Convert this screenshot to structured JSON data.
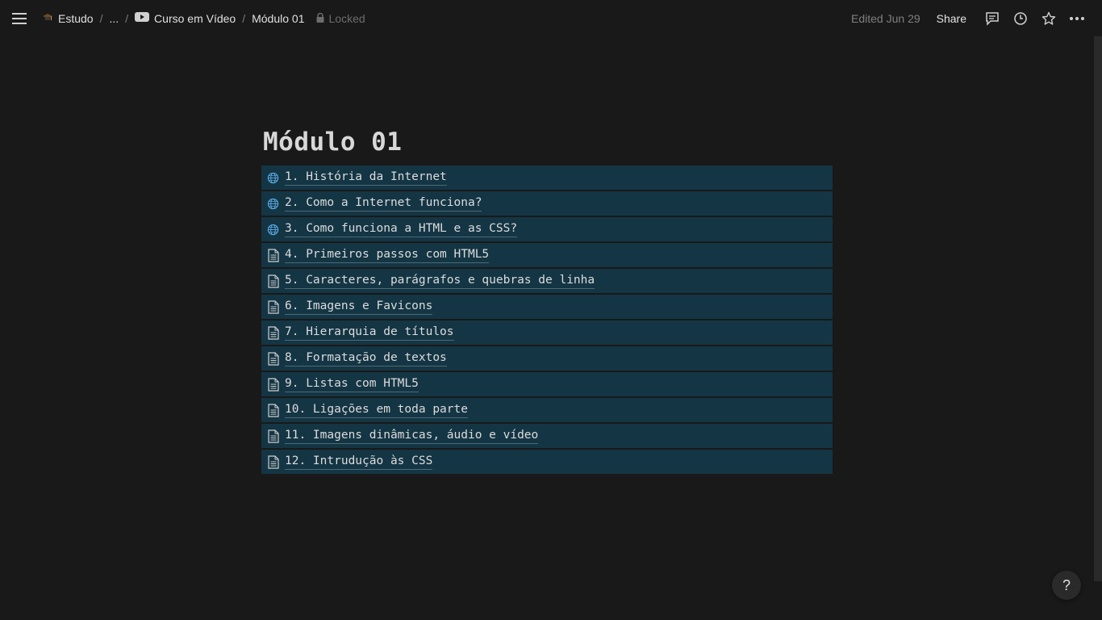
{
  "header": {
    "breadcrumbs": [
      {
        "label": "Estudo",
        "icon": "graduation-cap-icon"
      },
      {
        "label": "..."
      },
      {
        "label": "Curso em Vídeo",
        "icon": "youtube-icon"
      },
      {
        "label": "Módulo 01"
      }
    ],
    "locked_label": "Locked",
    "edited_label": "Edited Jun 29",
    "share_label": "Share"
  },
  "page": {
    "title": "Módulo 01",
    "items": [
      {
        "label": "1. História da Internet",
        "icon": "globe-icon"
      },
      {
        "label": "2. Como a Internet funciona?",
        "icon": "globe-icon"
      },
      {
        "label": "3. Como funciona a HTML e as CSS?",
        "icon": "globe-icon"
      },
      {
        "label": "4. Primeiros passos com HTML5",
        "icon": "page-icon"
      },
      {
        "label": "5. Caracteres, parágrafos e quebras de linha",
        "icon": "page-icon"
      },
      {
        "label": "6. Imagens e Favicons",
        "icon": "page-icon"
      },
      {
        "label": "7. Hierarquia de títulos",
        "icon": "page-icon"
      },
      {
        "label": "8. Formatação de textos",
        "icon": "page-icon"
      },
      {
        "label": "9. Listas com HTML5",
        "icon": "page-icon"
      },
      {
        "label": "10. Ligações em toda parte",
        "icon": "page-icon"
      },
      {
        "label": "11. Imagens dinâmicas, áudio e vídeo",
        "icon": "page-icon"
      },
      {
        "label": "12. Intrudução às CSS",
        "icon": "page-icon"
      }
    ]
  },
  "help": {
    "label": "?"
  },
  "colors": {
    "background": "#191919",
    "item_background": "#143544",
    "globe": "#5aa9e0"
  }
}
